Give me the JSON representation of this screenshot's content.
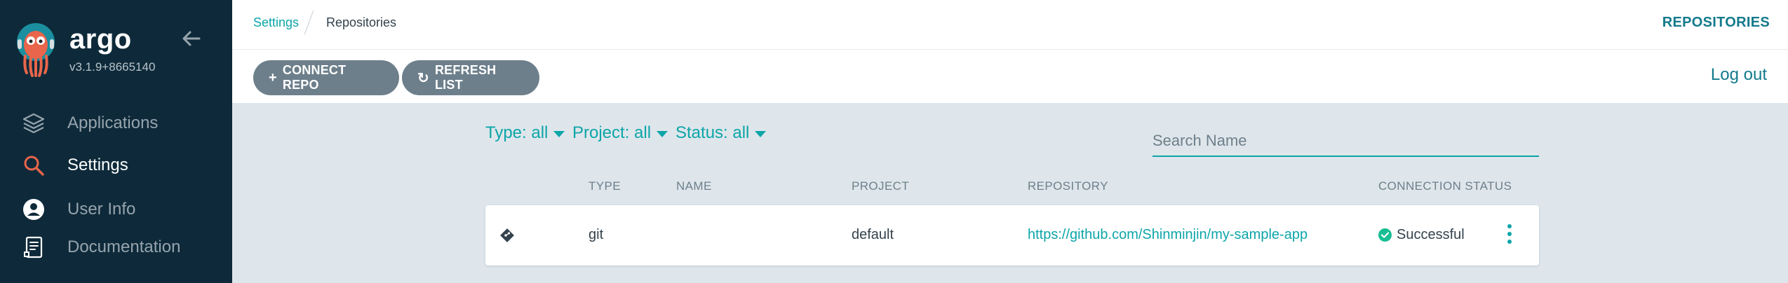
{
  "app": {
    "name": "argo",
    "version": "v3.1.9+8665140"
  },
  "sidebar": {
    "items": [
      {
        "label": "Applications",
        "icon": "layers-icon"
      },
      {
        "label": "Settings",
        "icon": "search-icon"
      },
      {
        "label": "User Info",
        "icon": "user-icon"
      },
      {
        "label": "Documentation",
        "icon": "document-icon"
      }
    ]
  },
  "breadcrumb": {
    "parent": "Settings",
    "current": "Repositories"
  },
  "header": {
    "title": "REPOSITORIES"
  },
  "toolbar": {
    "connect_label": "CONNECT REPO",
    "refresh_label": "REFRESH LIST",
    "logout_label": "Log out"
  },
  "filters": {
    "type": "Type: all",
    "project": "Project: all",
    "status": "Status: all"
  },
  "search": {
    "placeholder": "Search Name"
  },
  "table": {
    "columns": [
      "TYPE",
      "NAME",
      "PROJECT",
      "REPOSITORY",
      "CONNECTION STATUS"
    ],
    "rows": [
      {
        "type": "git",
        "name": "",
        "project": "default",
        "repository": "https://github.com/Shinminjin/my-sample-app",
        "status": "Successful"
      }
    ]
  },
  "colors": {
    "sidebar_bg": "#0e2a3a",
    "accent": "#0da5a8",
    "button_bg": "#6d7f8b",
    "success": "#18be94",
    "content_bg": "#dee6eb"
  }
}
